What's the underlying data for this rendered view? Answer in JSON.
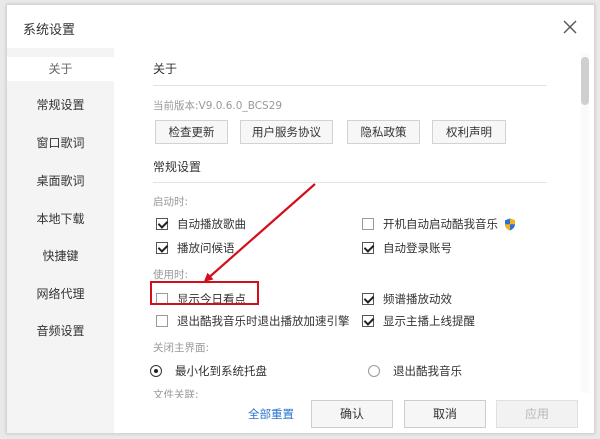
{
  "window": {
    "title": "系统设置",
    "close_icon": "close-icon"
  },
  "sidebar": {
    "items": [
      {
        "label": "关于",
        "active": true
      },
      {
        "label": "常规设置",
        "active": false
      },
      {
        "label": "窗口歌词",
        "active": false
      },
      {
        "label": "桌面歌词",
        "active": false
      },
      {
        "label": "本地下载",
        "active": false
      },
      {
        "label": "快捷键",
        "active": false
      },
      {
        "label": "网络代理",
        "active": false
      },
      {
        "label": "音频设置",
        "active": false
      }
    ]
  },
  "about": {
    "title": "关于",
    "version": "当前版本:V9.0.6.0_BCS29",
    "buttons": [
      "检查更新",
      "用户服务协议",
      "隐私政策",
      "权利声明"
    ]
  },
  "general": {
    "title": "常规设置",
    "startup_label": "启动时:",
    "startup_options": [
      {
        "label": "自动播放歌曲",
        "checked": true
      },
      {
        "label": "开机自动启动酷我音乐",
        "checked": false
      },
      {
        "label": "播放问候语",
        "checked": true
      },
      {
        "label": "自动登录账号",
        "checked": true
      }
    ],
    "usage_label": "使用时:",
    "usage_options": [
      {
        "label": "显示今日看点",
        "checked": false
      },
      {
        "label": "频谱播放动效",
        "checked": true
      },
      {
        "label": "退出酷我音乐时退出播放加速引擎",
        "checked": false
      },
      {
        "label": "显示主播上线提醒",
        "checked": true
      }
    ],
    "close_main_label": "关闭主界面:",
    "close_main_options": [
      {
        "label": "最小化到系统托盘",
        "selected": true
      },
      {
        "label": "退出酷我音乐",
        "selected": false
      }
    ],
    "cut_label": "文件关联:"
  },
  "footer": {
    "reset_all": "全部重置",
    "ok": "确认",
    "cancel": "取消",
    "apply": "应用"
  },
  "colors": {
    "annotation": "#d40f1c",
    "link": "#2a73d0",
    "sidebar_bg": "#f4f4f4"
  }
}
